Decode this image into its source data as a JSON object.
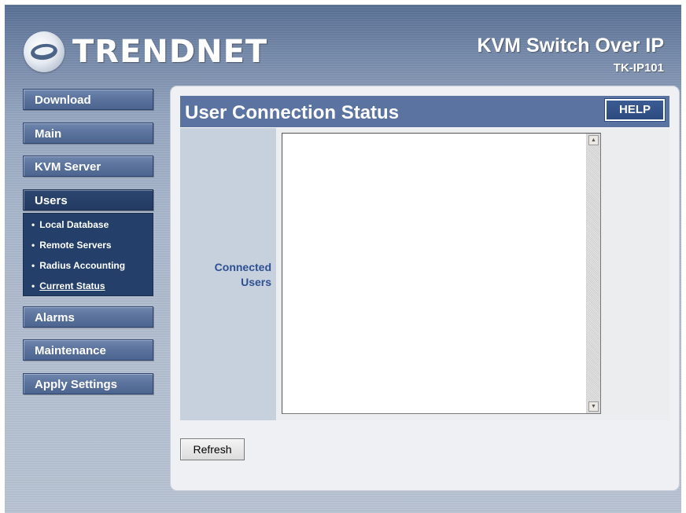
{
  "header": {
    "brand": "TRENDNET",
    "product": "KVM Switch Over IP",
    "model": "TK-IP101"
  },
  "sidebar": {
    "items": [
      {
        "label": "Download"
      },
      {
        "label": "Main"
      },
      {
        "label": "KVM Server"
      },
      {
        "label": "Users"
      },
      {
        "label": "Alarms"
      },
      {
        "label": "Maintenance"
      },
      {
        "label": "Apply Settings"
      }
    ],
    "users_submenu": [
      {
        "label": "Local Database"
      },
      {
        "label": "Remote Servers"
      },
      {
        "label": "Radius Accounting"
      },
      {
        "label": "Current Status"
      }
    ],
    "bullet": "•"
  },
  "panel": {
    "title": "User Connection Status",
    "help_label": "HELP",
    "connected_label_line1": "Connected",
    "connected_label_line2": "Users",
    "connected_users_value": "",
    "refresh_label": "Refresh"
  },
  "icons": {
    "scroll_up": "▲",
    "scroll_down": "▼"
  }
}
